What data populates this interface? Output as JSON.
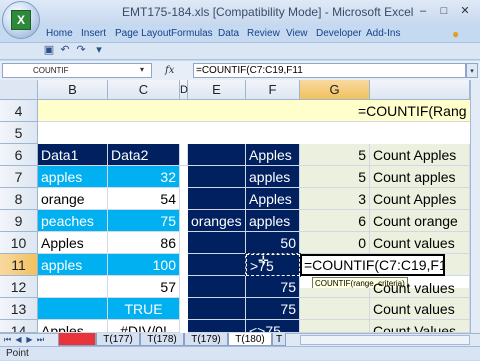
{
  "window": {
    "title": "EMT175-184.xls  [Compatibility Mode] - Microsoft Excel",
    "minimize": "–",
    "maximize": "□",
    "close": "✕"
  },
  "ribbon_tabs": [
    "Home",
    "Insert",
    "Page Layout",
    "Formulas",
    "Data",
    "Review",
    "View",
    "Developer",
    "Add-Ins"
  ],
  "formula_bar": {
    "name_box": "COUNTIF",
    "fx": "fx",
    "formula": "=COUNTIF(C7:C19,F11"
  },
  "columns": [
    "B",
    "C",
    "D",
    "E",
    "F",
    "G"
  ],
  "selected_column": "G",
  "rows": [
    "4",
    "5",
    "6",
    "7",
    "8",
    "9",
    "10",
    "11",
    "12",
    "13",
    "14"
  ],
  "selected_row": "11",
  "cells": {
    "G4": "=COUNTIF(Rang",
    "B6": "Data1",
    "C6": "Data2",
    "F6": "Apples",
    "G6": "5",
    "H6": "Count Apples",
    "B7": "apples",
    "C7": "32",
    "F7": "apples",
    "G7": "5",
    "H7": "Count apples",
    "B8": "orange",
    "C8": "54",
    "F8": "Apples",
    "G8": "3",
    "H8": "Count Apples",
    "B9": "peaches",
    "C9": "75",
    "E9": "oranges",
    "F9": "apples",
    "G9": "6",
    "H9": "Count  orange",
    "B10": "Apples",
    "C10": "86",
    "F10": "50",
    "G10": "0",
    "H10": "Count values",
    "B11": "apples",
    "C11": "100",
    "F11": ">75",
    "G11": "=COUNTIF(C7:C19,F11",
    "C12": "57",
    "F12": "75",
    "H12": "Count values",
    "C13": "TRUE",
    "F13": "75",
    "H13": "Count values",
    "B14": "Apples",
    "C14": "#DIV/0!",
    "F14": "<>75",
    "H14": "Count Values"
  },
  "tooltip": "COUNTIF(range, criteria)",
  "sheet_tabs": [
    "T(177)",
    "T(178)",
    "T(179)",
    "T(180)",
    "T"
  ],
  "active_sheet": "T(180)",
  "status": "Point",
  "icons": [
    "office-logo",
    "save-icon",
    "undo-icon",
    "redo-icon",
    "dropdown-icon"
  ]
}
